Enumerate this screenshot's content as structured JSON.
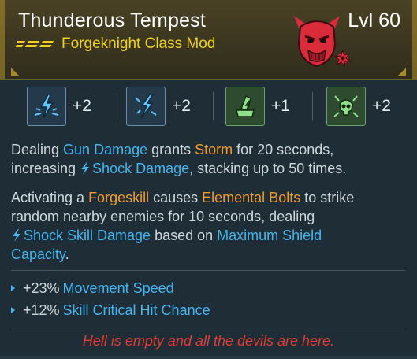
{
  "item": {
    "title": "Thunderous Tempest",
    "level": "Lvl 60",
    "subtitle": "Forgeknight Class Mod",
    "rarity_color": "#f0d020",
    "emblem_icon": "red-demon-head-icon"
  },
  "skills": [
    {
      "icon": "shock-burst-icon",
      "value": "+2",
      "tint": "blue"
    },
    {
      "icon": "lightning-strike-icon",
      "value": "+2",
      "tint": "blue"
    },
    {
      "icon": "forge-hammer-shock-icon",
      "value": "+1",
      "tint": "green"
    },
    {
      "icon": "skull-shock-icon",
      "value": "+2",
      "tint": "green"
    }
  ],
  "description": {
    "p1": {
      "t1": "Dealing ",
      "gun_damage": "Gun Damage",
      "t2": " grants ",
      "storm": "Storm",
      "t3": " for 20 seconds,",
      "t4": "increasing ",
      "shock_damage": "Shock Damage",
      "t5": ", stacking up to 50 times."
    },
    "p2": {
      "t1": "Activating a ",
      "forgeskill": "Forgeskill",
      "t2": " causes ",
      "elemental_bolts": "Elemental Bolts",
      "t3": " to strike",
      "line2": "random nearby enemies for 10 seconds, dealing",
      "shock_skill_damage": "Shock Skill Damage",
      "t4": " based on ",
      "max_shield": "Maximum Shield",
      "capacity": "Capacity",
      "t5": "."
    }
  },
  "stats": [
    {
      "value": "+23%",
      "label": "Movement Speed"
    },
    {
      "value": "+12%",
      "label": "Skill Critical Hit Chance"
    }
  ],
  "flavor": "Hell is empty and all the devils are here.",
  "colors": {
    "keyword_blue": "#43b6f0",
    "keyword_orange": "#f39a2c",
    "flavor_red": "#e23a34",
    "header_gold": "#4a4224"
  }
}
